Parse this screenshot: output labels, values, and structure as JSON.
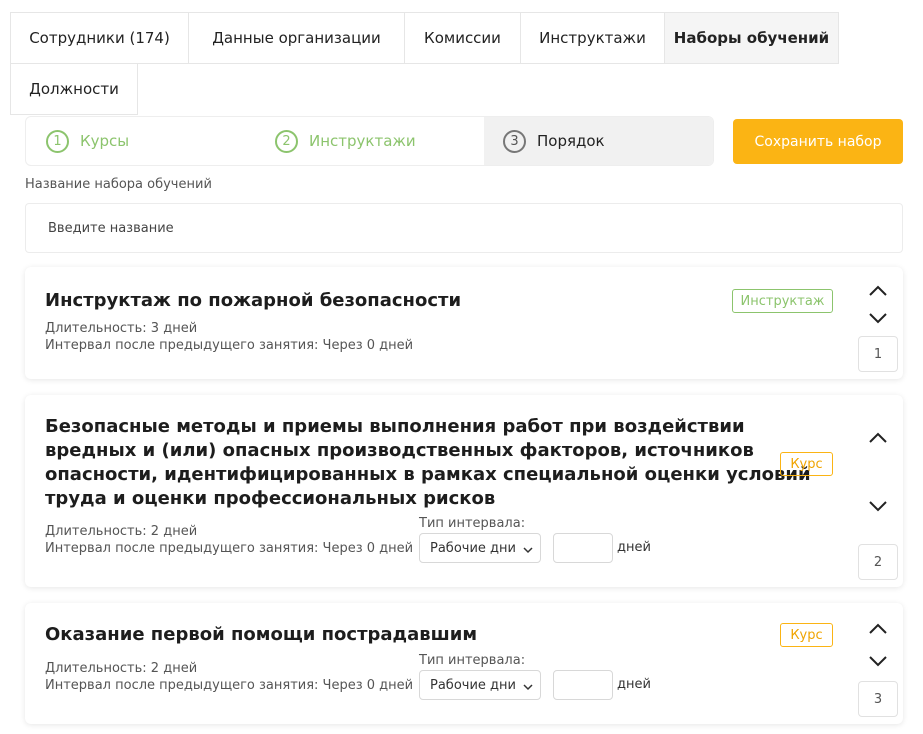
{
  "tabs": [
    {
      "label": "Сотрудники (174)"
    },
    {
      "label": "Данные организации"
    },
    {
      "label": "Комиссии"
    },
    {
      "label": "Инструктажи"
    },
    {
      "label": "Наборы обучений"
    },
    {
      "label": "Должности"
    }
  ],
  "stepper": {
    "steps": [
      {
        "num": "1",
        "label": "Курсы"
      },
      {
        "num": "2",
        "label": "Инструктажи"
      },
      {
        "num": "3",
        "label": "Порядок"
      }
    ]
  },
  "save_button": "Сохранить набор",
  "form": {
    "name_label": "Название набора обучений",
    "name_placeholder": "Введите название",
    "name_value": ""
  },
  "items": [
    {
      "title": "Инструктаж по пожарной безопасности",
      "badge": "Инструктаж",
      "duration": "Длительность: 3 дней",
      "interval": "Интервал после предыдущего занятия: Через 0 дней",
      "order": "1"
    },
    {
      "title_lines": [
        "Безопасные методы и приемы выполнения работ при воздействии",
        "вредных и (или) опасных производственных факторов, источников",
        "опасности, идентифицированных в рамках специальной оценки условий",
        "труда и оценки профессиональных рисков"
      ],
      "badge": "Курс",
      "duration": "Длительность: 2 дней",
      "interval": "Интервал после предыдущего занятия: Через 0 дней",
      "interval_type_label": "Тип интервала:",
      "interval_type_value": "Рабочие дни",
      "days_value": "",
      "days_suffix": "дней",
      "order": "2"
    },
    {
      "title": "Оказание первой помощи пострадавшим",
      "badge": "Курс",
      "duration": "Длительность: 2 дней",
      "interval": "Интервал после предыдущего занятия: Через 0 дней",
      "interval_type_label": "Тип интервала:",
      "interval_type_value": "Рабочие дни",
      "days_value": "",
      "days_suffix": "дней",
      "order": "3"
    }
  ],
  "colors": {
    "accent": "#fbb414",
    "success": "#8cc46d"
  },
  "icons": {
    "up": "chevron-up-icon",
    "down": "chevron-down-icon"
  }
}
